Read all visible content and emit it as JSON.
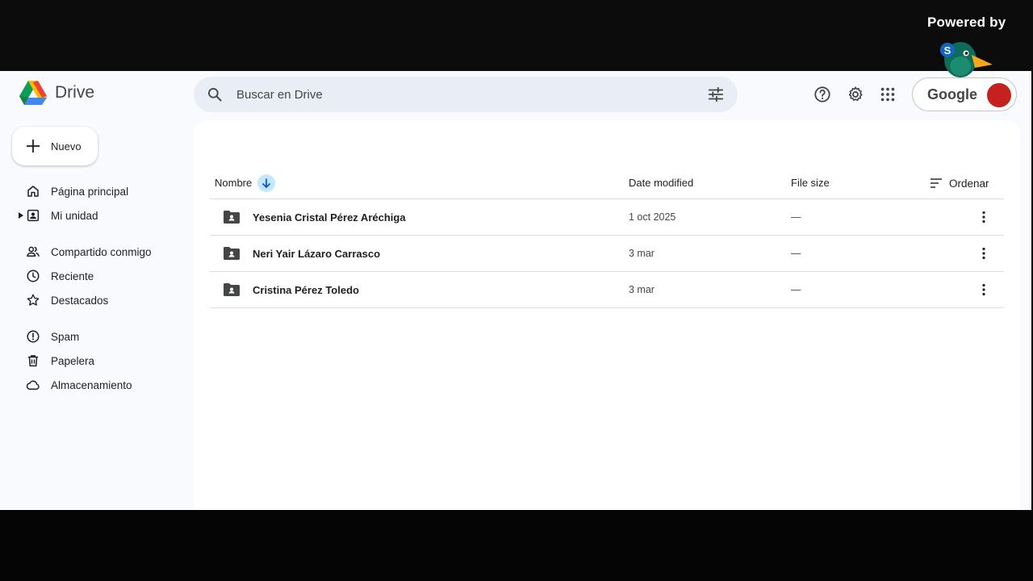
{
  "watermark": {
    "text": "Powered by"
  },
  "header": {
    "app_name": "Drive",
    "search_placeholder": "Buscar en Drive",
    "org_name": "Google"
  },
  "sidebar": {
    "new_label": "Nuevo",
    "items": [
      {
        "label": "Página principal",
        "icon": "home-icon"
      },
      {
        "label": "Mi unidad",
        "icon": "my-drive-icon"
      },
      {
        "label": "Compartido conmigo",
        "icon": "shared-icon"
      },
      {
        "label": "Reciente",
        "icon": "clock-icon"
      },
      {
        "label": "Destacados",
        "icon": "star-icon"
      },
      {
        "label": "Spam",
        "icon": "spam-icon"
      },
      {
        "label": "Papelera",
        "icon": "trash-icon"
      },
      {
        "label": "Almacenamiento",
        "icon": "cloud-icon"
      }
    ]
  },
  "table": {
    "columns": {
      "name": "Nombre",
      "modified": "Date modified",
      "size": "File size"
    },
    "sort_label": "Ordenar",
    "rows": [
      {
        "name": "Yesenia Cristal Pérez Aréchiga",
        "modified": "1 oct 2025",
        "size": "—"
      },
      {
        "name": "Neri Yair Lázaro Carrasco",
        "modified": "3 mar",
        "size": "—"
      },
      {
        "name": "Cristina Pérez Toledo",
        "modified": "3 mar",
        "size": "—"
      }
    ]
  },
  "colors": {
    "accent": "#0b57d0",
    "sort_chip": "#c2e7ff",
    "background": "#f8fafd",
    "search_bg": "#e9eef6"
  }
}
